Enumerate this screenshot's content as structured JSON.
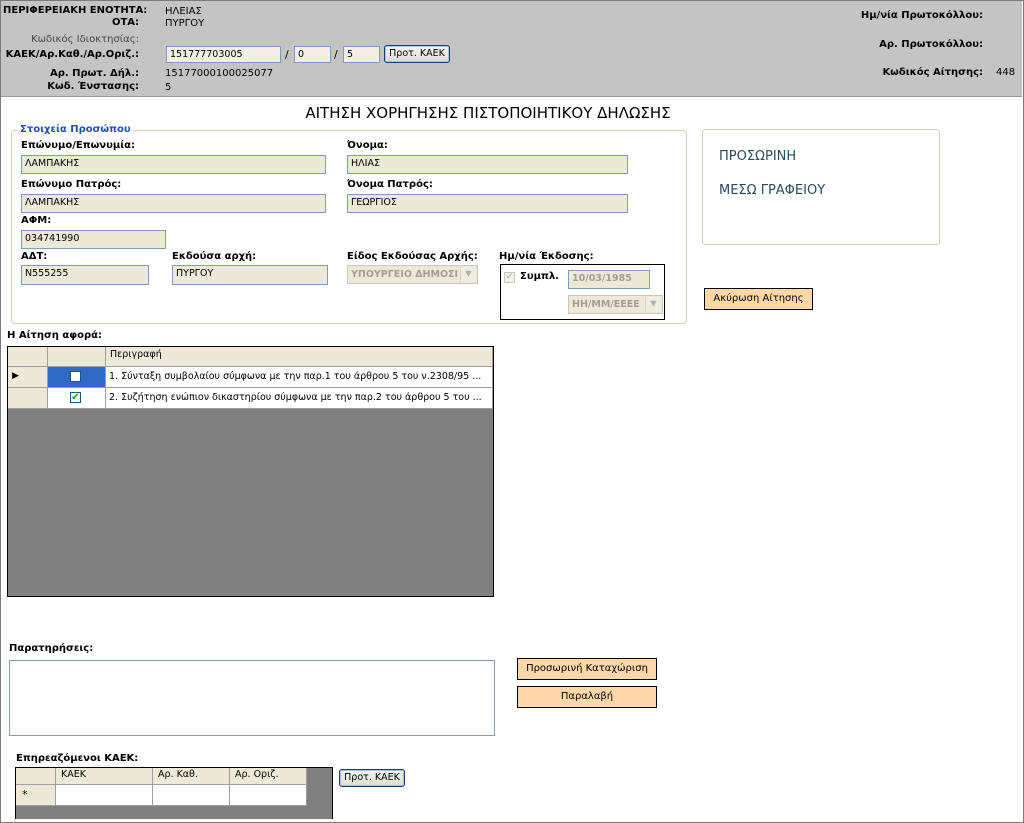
{
  "header": {
    "perif_label": "ΠΕΡΙΦΕΡΕΙΑΚΗ ΕΝΟΤΗΤΑ:",
    "perif_value": "ΗΛΕΙΑΣ",
    "ota_label": "ΟΤΑ:",
    "ota_value": "ΠΥΡΓΟΥ",
    "kodikos_label": "Κωδικός Ιδιοκτησίας:",
    "kaek_label": "ΚΑΕΚ/Αρ.Καθ./Αρ.Οριζ.:",
    "kaek_value": "151777703005",
    "sep1": "/",
    "ar_kath_value": "0",
    "sep2": "/",
    "ar_oriz_value": "5",
    "prot_kaek_btn": "Προτ. ΚΑΕΚ",
    "ar_prot_dil_label": "Αρ. Πρωτ. Δήλ.:",
    "ar_prot_dil_value": "15177000100025077",
    "kod_enstasis_label": "Κωδ. Ένστασης:",
    "kod_enstasis_value": "5",
    "im_protokollou_label": "Ημ/νία Πρωτοκόλλου:",
    "ar_protokollou_label": "Αρ. Πρωτοκόλλου:",
    "kodikos_aitisis_label": "Κωδικός Αίτησης:",
    "kodikos_aitisis_value": "448"
  },
  "title": "ΑΙΤΗΣΗ ΧΟΡΗΓΗΣΗΣ ΠΙΣΤΟΠΟΙΗΤΙΚΟΥ ΔΗΛΩΣΗΣ",
  "person": {
    "legend": "Στοιχεία Προσώπου",
    "eponymo_label": "Επώνυμο/Επωνυμία:",
    "eponymo_value": "ΛΑΜΠΑΚΗΣ",
    "onoma_label": "Όνομα:",
    "onoma_value": "ΗΛΙΑΣ",
    "eponymo_patros_label": "Επώνυμο Πατρός:",
    "eponymo_patros_value": "ΛΑΜΠΑΚΗΣ",
    "onoma_patros_label": "Όνομα Πατρός:",
    "onoma_patros_value": "ΓΕΩΡΓΙΟΣ",
    "afm_label": "ΑΦΜ:",
    "afm_value": "034741990",
    "adt_label": "ΑΔΤ:",
    "adt_value": "Ν555255",
    "ekdousa_label": "Εκδούσα αρχή:",
    "ekdousa_value": "ΠΥΡΓΟΥ",
    "eidos_label": "Είδος Εκδούσας Αρχής:",
    "eidos_value": "ΥΠΟΥΡΓΕΙΟ ΔΗΜΟΣΙ",
    "im_ekdosis_label": "Ημ/νία Έκδοσης:",
    "sympl_label": "Συμπλ.",
    "date_value": "10/03/1985",
    "date_format_value": "ΗΗ/ΜΜ/ΕΕΕΕ"
  },
  "status": {
    "line1": "ΠΡΟΣΩΡΙΝΗ",
    "line2": "ΜΕΣΩ ΓΡΑΦΕΙΟΥ"
  },
  "akyrosi_btn": "Ακύρωση Αίτησης",
  "aitisi_afora": {
    "label": "Η Αίτηση αφορά:",
    "col_header": "Περιγραφή",
    "rows": [
      {
        "text": "1. Σύνταξη συμβολαίου σύμφωνα με την παρ.1 του άρθρου 5 του ν.2308/95 ...",
        "checked": false
      },
      {
        "text": "2. Συζήτηση ενώπιον δικαστηρίου σύμφωνα με την παρ.2 του άρθρου 5 του ...",
        "checked": true
      }
    ]
  },
  "paratiriseis_label": "Παρατηρήσεις:",
  "prosorini_btn": "Προσωρινή Καταχώριση",
  "paralavi_btn": "Παραλαβή",
  "kaek_table": {
    "label": "Επηρεαζόμενοι ΚΑΕΚ:",
    "columns": [
      "ΚΑΕΚ",
      "Αρ. Καθ.",
      "Αρ. Οριζ."
    ],
    "new_row_marker": "*",
    "prot_kaek_btn": "Προτ. ΚΑΕΚ"
  }
}
